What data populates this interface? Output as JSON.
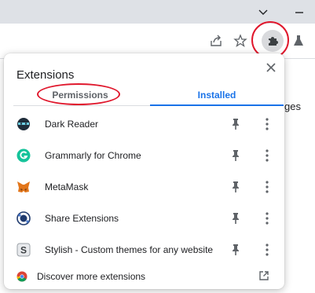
{
  "popup": {
    "title": "Extensions",
    "tabs": [
      {
        "label": "Permissions",
        "active": false
      },
      {
        "label": "Installed",
        "active": true
      }
    ],
    "extensions": [
      {
        "name": "Dark Reader",
        "icon": "dark-reader-icon"
      },
      {
        "name": "Grammarly for Chrome",
        "icon": "grammarly-icon"
      },
      {
        "name": "MetaMask",
        "icon": "metamask-fox-icon"
      },
      {
        "name": "Share Extensions",
        "icon": "share-extensions-icon"
      },
      {
        "name": "Stylish - Custom themes for any website",
        "icon": "stylish-icon"
      }
    ],
    "footer_link": "Discover more extensions"
  },
  "background": {
    "partial_text": "ges"
  },
  "colors": {
    "accent": "#1a73e8",
    "annotation": "#e0182d",
    "grammarly": "#15c39a"
  }
}
